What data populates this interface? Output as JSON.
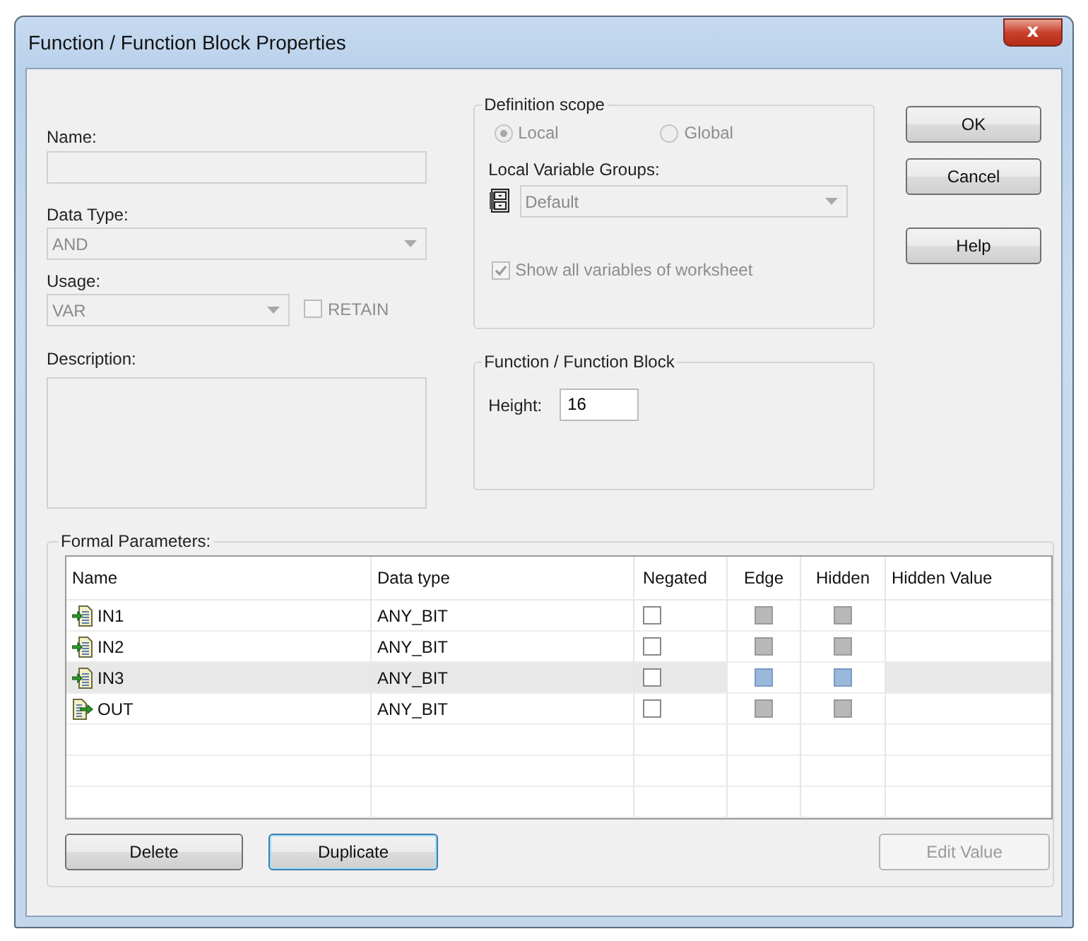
{
  "window": {
    "title": "Function / Function Block Properties",
    "close": "x"
  },
  "name": {
    "label": "Name:",
    "disabled": true
  },
  "data_type": {
    "label": "Data Type:",
    "value": "AND",
    "disabled": true
  },
  "usage": {
    "label": "Usage:",
    "value": "VAR",
    "disabled": true
  },
  "retain": {
    "label": "RETAIN",
    "checked": false,
    "disabled": true
  },
  "description": {
    "label": "Description:",
    "disabled": true
  },
  "definition_scope": {
    "title": "Definition scope",
    "options": [
      {
        "label": "Local",
        "selected": true,
        "disabled": true
      },
      {
        "label": "Global",
        "selected": false,
        "disabled": true
      }
    ],
    "groups_label": "Local Variable Groups:",
    "groups_value": "Default",
    "groups_disabled": true,
    "show_all": {
      "label": "Show all variables of worksheet",
      "checked": true,
      "disabled": true
    }
  },
  "function_block": {
    "title": "Function / Function Block",
    "height_label": "Height:",
    "height_value": "16"
  },
  "buttons": [
    {
      "label": "OK",
      "disabled": false
    },
    {
      "label": "Cancel",
      "disabled": false
    },
    {
      "label": "Help",
      "disabled": false
    }
  ],
  "formal_parameters": {
    "title": "Formal Parameters:",
    "columns": [
      "Name",
      "Data type",
      "Negated",
      "Edge",
      "Hidden",
      "Hidden Value"
    ],
    "rows": [
      {
        "kind": "input",
        "name": "IN1",
        "data_type": "ANY_BIT",
        "negated": false,
        "edge": false,
        "edge_disabled": true,
        "hidden": false,
        "hidden_disabled": true,
        "selected": false
      },
      {
        "kind": "input",
        "name": "IN2",
        "data_type": "ANY_BIT",
        "negated": false,
        "edge": false,
        "edge_disabled": true,
        "hidden": false,
        "hidden_disabled": true,
        "selected": false
      },
      {
        "kind": "input",
        "name": "IN3",
        "data_type": "ANY_BIT",
        "negated": false,
        "edge": false,
        "edge_disabled": true,
        "hidden": false,
        "hidden_disabled": true,
        "selected": true
      },
      {
        "kind": "output",
        "name": "OUT",
        "data_type": "ANY_BIT",
        "negated": false,
        "edge": false,
        "edge_disabled": true,
        "hidden": false,
        "hidden_disabled": true,
        "selected": false
      }
    ],
    "buttons": [
      {
        "label": "Delete",
        "disabled": false,
        "focused": false
      },
      {
        "label": "Duplicate",
        "disabled": false,
        "focused": true
      },
      {
        "label": "Edit Value",
        "disabled": true,
        "focused": false
      }
    ]
  }
}
